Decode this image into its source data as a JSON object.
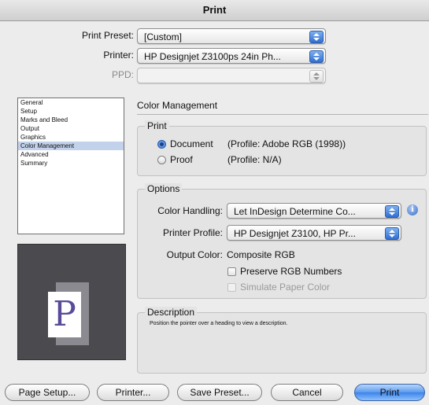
{
  "window": {
    "title": "Print"
  },
  "header": {
    "preset_label": "Print Preset:",
    "preset_value": "[Custom]",
    "printer_label": "Printer:",
    "printer_value": "HP Designjet Z3100ps 24in Ph...",
    "ppd_label": "PPD:",
    "ppd_value": ""
  },
  "sidebar": {
    "items": [
      {
        "label": "General"
      },
      {
        "label": "Setup"
      },
      {
        "label": "Marks and Bleed"
      },
      {
        "label": "Output"
      },
      {
        "label": "Graphics"
      },
      {
        "label": "Color Management"
      },
      {
        "label": "Advanced"
      },
      {
        "label": "Summary"
      }
    ],
    "selected": "Color Management"
  },
  "preview": {
    "glyph": "P"
  },
  "main": {
    "section_title": "Color Management",
    "print_group": {
      "title": "Print",
      "document_label": "Document",
      "document_profile": "(Profile: Adobe RGB (1998))",
      "proof_label": "Proof",
      "proof_profile": "(Profile: N/A)",
      "selected": "Document"
    },
    "options_group": {
      "title": "Options",
      "color_handling_label": "Color Handling:",
      "color_handling_value": "Let InDesign Determine Co...",
      "printer_profile_label": "Printer Profile:",
      "printer_profile_value": "HP Designjet Z3100, HP Pr...",
      "output_color_label": "Output Color:",
      "output_color_value": "Composite RGB",
      "preserve_rgb_label": "Preserve RGB Numbers",
      "simulate_paper_label": "Simulate Paper Color"
    },
    "description": {
      "title": "Description",
      "text": "Position the pointer over a heading to view a description."
    }
  },
  "buttons": {
    "page_setup": "Page Setup...",
    "printer": "Printer...",
    "save_preset": "Save Preset...",
    "cancel": "Cancel",
    "print": "Print"
  },
  "icons": {
    "info": "info-icon",
    "popup_arrow": "popup-arrows-icon"
  },
  "colors": {
    "accent": "#3a83ea",
    "sidebar_selection": "#c2d2ea",
    "preview_background": "#4a4a4f"
  }
}
